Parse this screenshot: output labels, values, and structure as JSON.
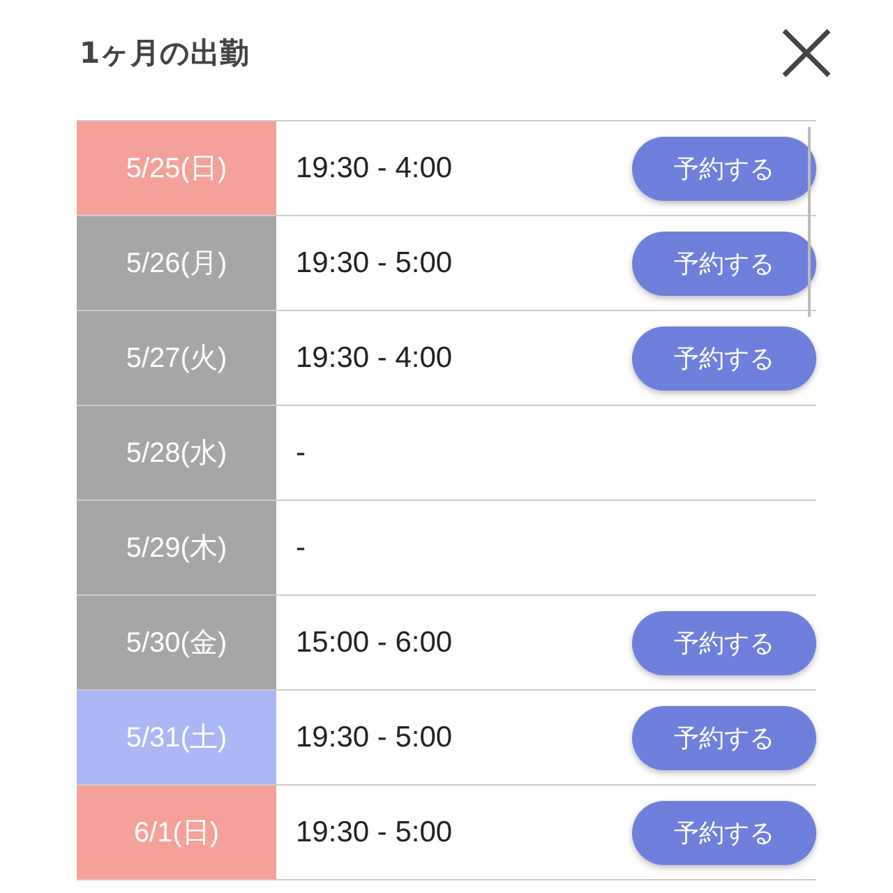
{
  "title": "1ヶ月の出勤",
  "rows": [
    {
      "date": "5/25(日)",
      "kind": "sunday",
      "time": "19:30 - 4:00",
      "button": "予約する"
    },
    {
      "date": "5/26(月)",
      "kind": "weekday",
      "time": "19:30 - 5:00",
      "button": "予約する"
    },
    {
      "date": "5/27(火)",
      "kind": "weekday",
      "time": "19:30 - 4:00",
      "button": "予約する"
    },
    {
      "date": "5/28(水)",
      "kind": "weekday",
      "time": "-"
    },
    {
      "date": "5/29(木)",
      "kind": "weekday",
      "time": "-"
    },
    {
      "date": "5/30(金)",
      "kind": "weekday",
      "time": "15:00 - 6:00",
      "button": "予約する"
    },
    {
      "date": "5/31(土)",
      "kind": "saturday",
      "time": "19:30 - 5:00",
      "button": "予約する"
    },
    {
      "date": "6/1(日)",
      "kind": "sunday",
      "time": "19:30 - 5:00",
      "button": "予約する"
    }
  ]
}
